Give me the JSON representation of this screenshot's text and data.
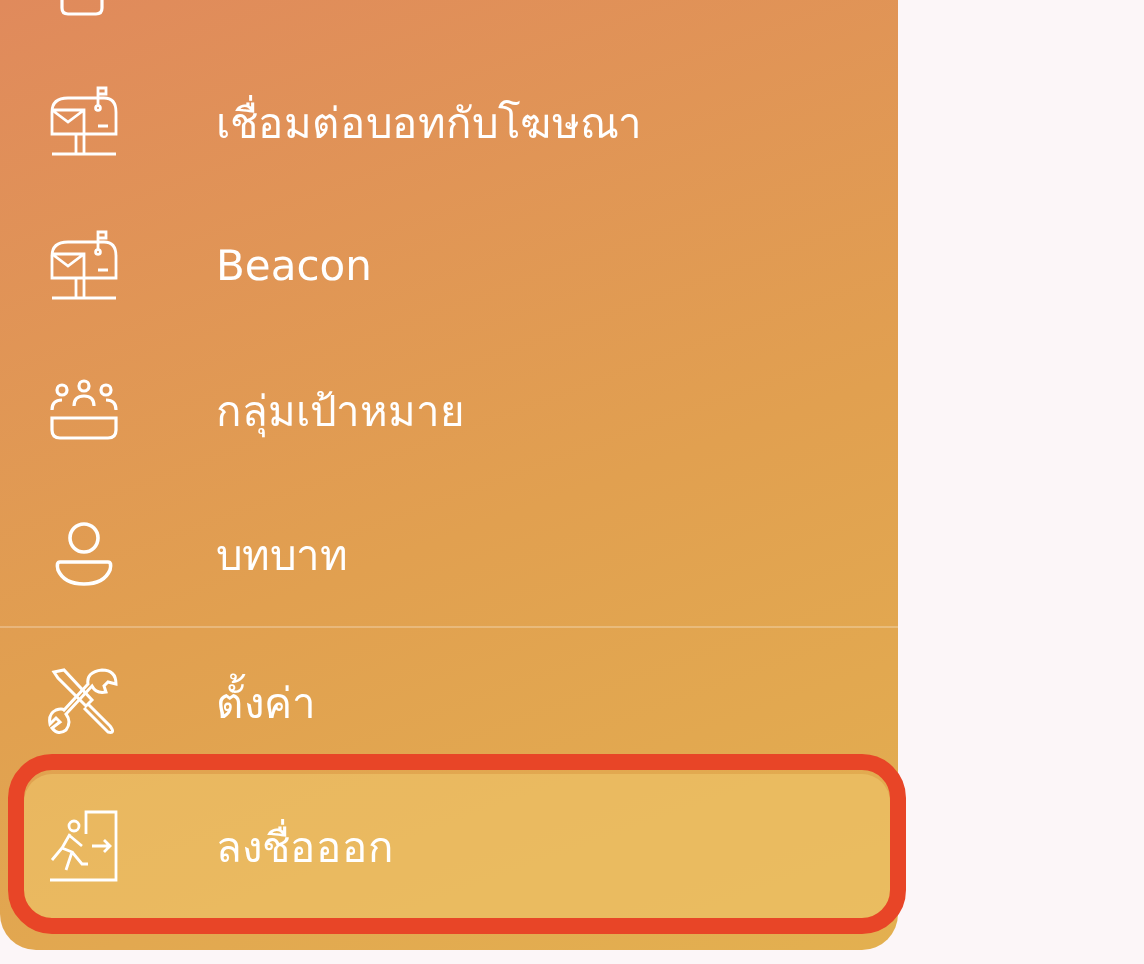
{
  "sidebar": {
    "sections": [
      {
        "items": [
          {
            "label": "เชื่อมต่อบอทกับโฆษณา",
            "kind": "mailbox",
            "selected": false,
            "marked": false
          },
          {
            "label": "Beacon",
            "kind": "mailbox",
            "selected": false,
            "marked": false
          },
          {
            "label": "กลุ่มเป้าหมาย",
            "kind": "group",
            "selected": false,
            "marked": false
          },
          {
            "label": "บทบาท",
            "kind": "person",
            "selected": false,
            "marked": false
          }
        ]
      },
      {
        "items": [
          {
            "label": "ตั้งค่า",
            "kind": "tools",
            "selected": false,
            "marked": false
          },
          {
            "label": "ลงชื่อออก",
            "kind": "exit",
            "selected": true,
            "marked": true
          }
        ]
      }
    ]
  }
}
